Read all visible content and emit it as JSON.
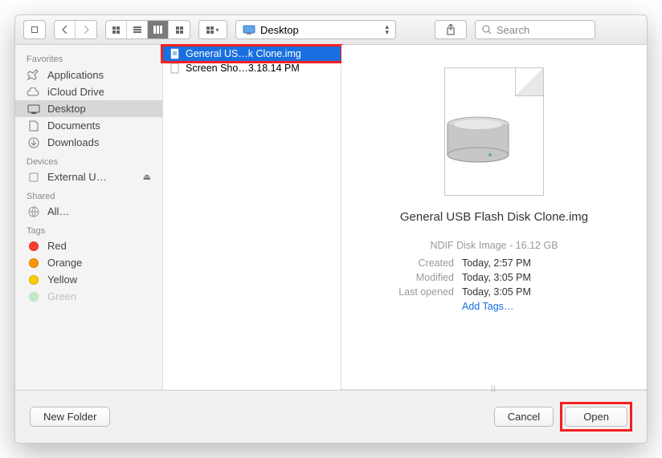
{
  "toolbar": {
    "path_label": "Desktop",
    "search_placeholder": "Search"
  },
  "sidebar": {
    "sections": [
      {
        "title": "Favorites",
        "items": [
          {
            "label": "Applications",
            "icon": "apps"
          },
          {
            "label": "iCloud Drive",
            "icon": "cloud"
          },
          {
            "label": "Desktop",
            "icon": "desktop",
            "selected": true
          },
          {
            "label": "Documents",
            "icon": "doc"
          },
          {
            "label": "Downloads",
            "icon": "down"
          }
        ]
      },
      {
        "title": "Devices",
        "items": [
          {
            "label": "External U…",
            "icon": "disk",
            "eject": true
          }
        ]
      },
      {
        "title": "Shared",
        "items": [
          {
            "label": "All…",
            "icon": "globe"
          }
        ]
      },
      {
        "title": "Tags",
        "items": [
          {
            "label": "Red",
            "color": "#ff3b30"
          },
          {
            "label": "Orange",
            "color": "#ff9500"
          },
          {
            "label": "Yellow",
            "color": "#ffcc00"
          },
          {
            "label": "Green",
            "color": "#4cd964"
          }
        ]
      }
    ]
  },
  "files": [
    {
      "name": "General US…k Clone.img",
      "icon": "img",
      "selected": true,
      "highlighted": true
    },
    {
      "name": "Screen Sho…3.18.14 PM",
      "icon": "png"
    }
  ],
  "preview": {
    "filename": "General USB Flash Disk Clone.img",
    "typeinfo": "NDIF Disk Image - 16.12 GB",
    "rows": {
      "created_k": "Created",
      "created_v": "Today, 2:57 PM",
      "modified_k": "Modified",
      "modified_v": "Today, 3:05 PM",
      "opened_k": "Last opened",
      "opened_v": "Today, 3:05 PM"
    },
    "addtags": "Add Tags…"
  },
  "buttons": {
    "newfolder": "New Folder",
    "cancel": "Cancel",
    "open": "Open"
  }
}
